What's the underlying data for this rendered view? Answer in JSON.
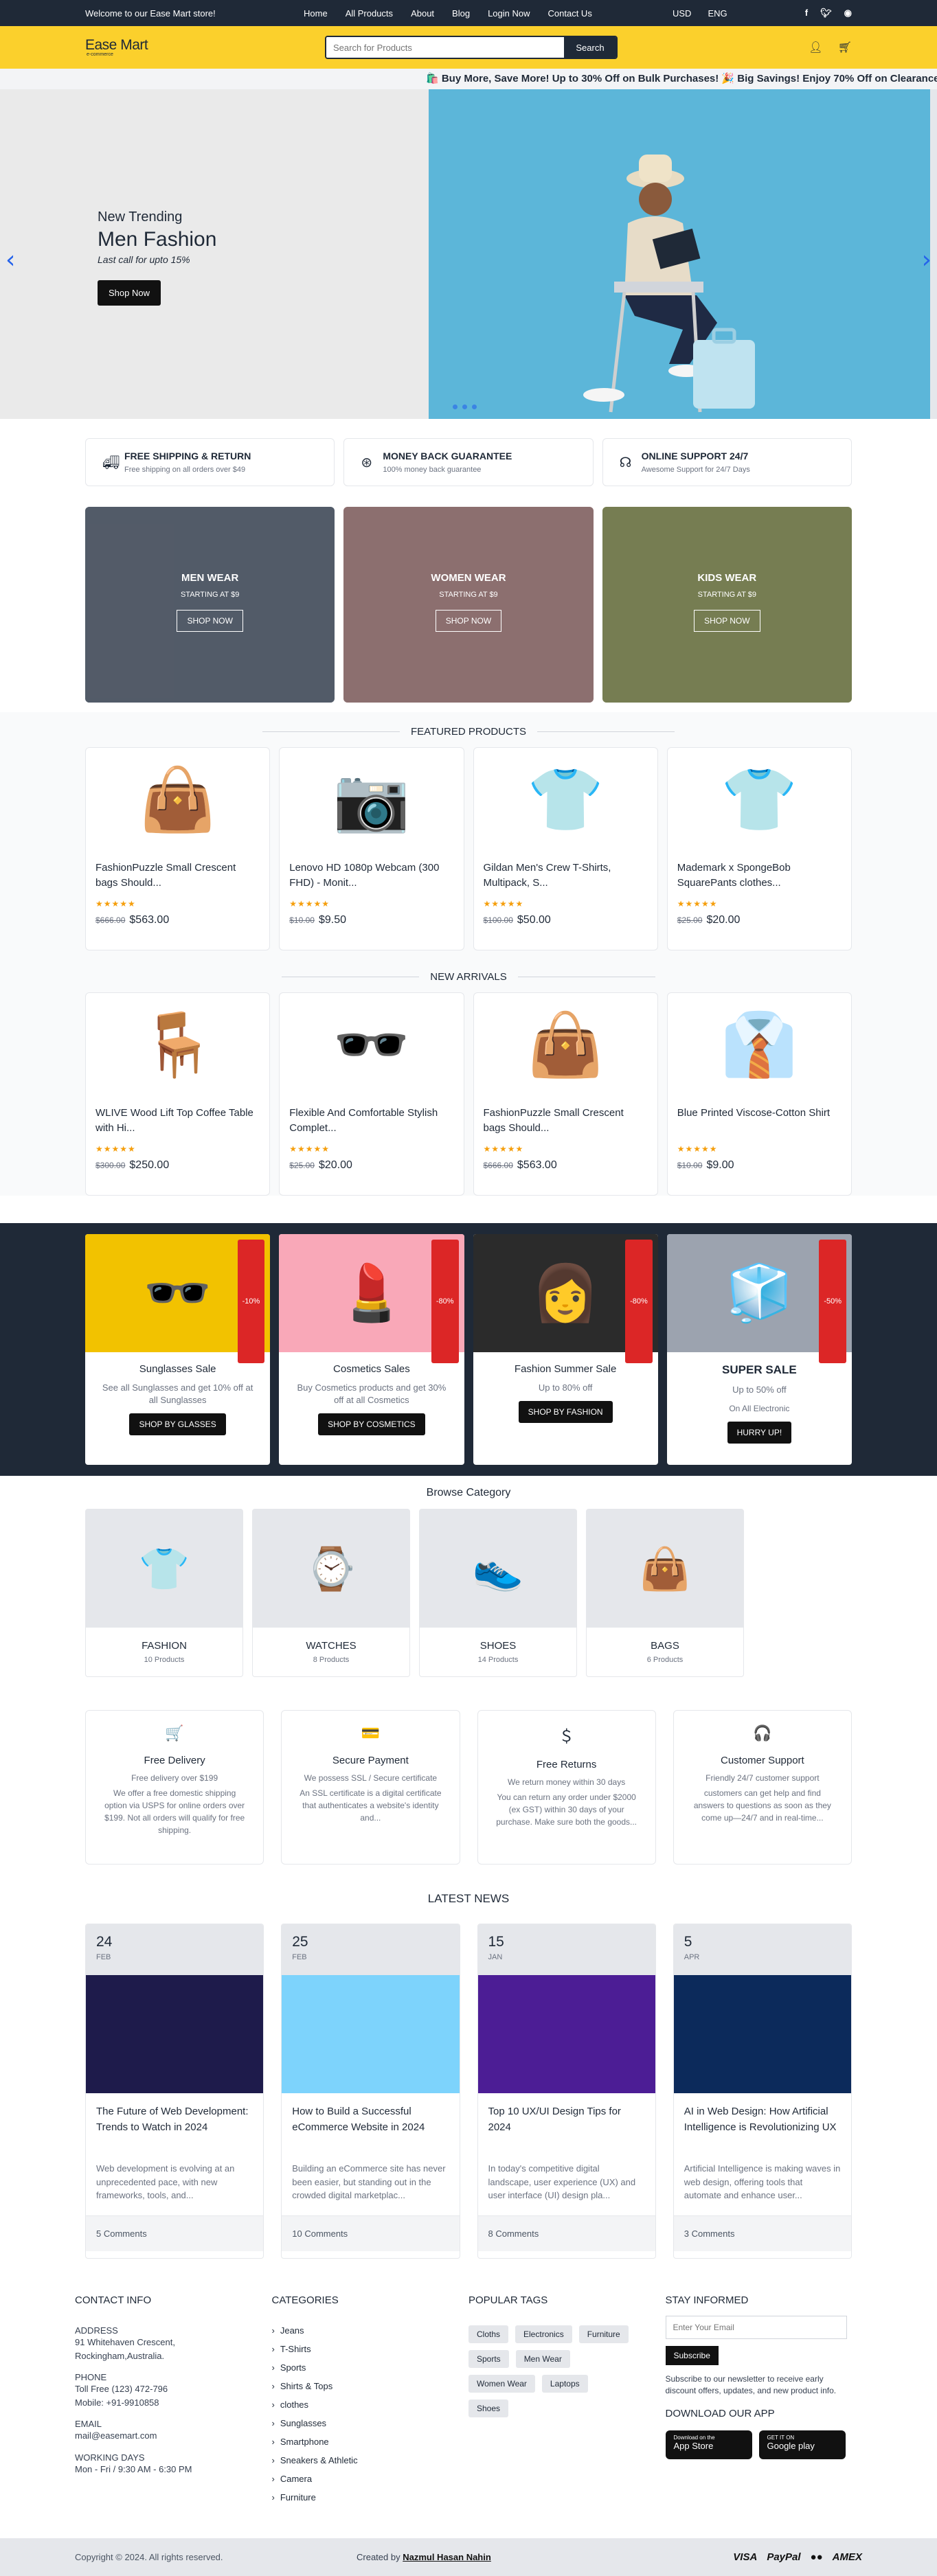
{
  "topbar": {
    "welcome": "Welcome to our Ease Mart store!",
    "nav": [
      "Home",
      "All Products",
      "About",
      "Blog",
      "Login Now",
      "Contact Us"
    ],
    "currency": "USD",
    "language": "ENG"
  },
  "header": {
    "logo": "Ease Mart",
    "logo_sub": "e-commerce",
    "search_placeholder": "Search for Products",
    "search_button": "Search"
  },
  "marquee": "🛍️ Buy More, Save More! Up to 30% Off on Bulk Purchases! 🎉 Big Savings! Enjoy 70% Off on Clearance Items",
  "hero": {
    "subtitle": "New Trending",
    "title": "Men Fashion",
    "note": "Last call for upto 15%",
    "button": "Shop Now"
  },
  "services": [
    {
      "title": "FREE SHIPPING & RETURN",
      "desc": "Free shipping on all orders over $49",
      "icon": "truck-icon"
    },
    {
      "title": "MONEY BACK GUARANTEE",
      "desc": "100% money back guarantee",
      "icon": "dollar-icon"
    },
    {
      "title": "ONLINE SUPPORT 24/7",
      "desc": "Awesome Support for 24/7 Days",
      "icon": "headset-icon"
    }
  ],
  "categories": [
    {
      "title": "MEN WEAR",
      "sub": "STARTING AT $9",
      "button": "SHOP NOW",
      "color": "#4a5d7a"
    },
    {
      "title": "WOMEN WEAR",
      "sub": "STARTING AT $9",
      "button": "SHOP NOW",
      "color": "#c98a8a"
    },
    {
      "title": "KIDS WEAR",
      "sub": "STARTING AT $9",
      "button": "SHOP NOW",
      "color": "#9aa84a"
    }
  ],
  "featured": {
    "heading": "FEATURED PRODUCTS",
    "items": [
      {
        "name": "FashionPuzzle Small Crescent bags Should...",
        "old": "$666.00",
        "price": "$563.00",
        "emoji": "👜"
      },
      {
        "name": "Lenovo HD 1080p Webcam (300 FHD) - Monit...",
        "old": "$10.00",
        "price": "$9.50",
        "emoji": "📷"
      },
      {
        "name": "Gildan Men's Crew T-Shirts, Multipack, S...",
        "old": "$100.00",
        "price": "$50.00",
        "emoji": "👕"
      },
      {
        "name": "Mademark x SpongeBob SquarePants clothes...",
        "old": "$25.00",
        "price": "$20.00",
        "emoji": "👕"
      }
    ]
  },
  "arrivals": {
    "heading": "NEW ARRIVALS",
    "items": [
      {
        "name": "WLIVE Wood Lift Top Coffee Table with Hi...",
        "old": "$300.00",
        "price": "$250.00",
        "emoji": "🪑"
      },
      {
        "name": "Flexible And Comfortable Stylish Complet...",
        "old": "$25.00",
        "price": "$20.00",
        "emoji": "🕶️"
      },
      {
        "name": "FashionPuzzle Small Crescent bags Should...",
        "old": "$666.00",
        "price": "$563.00",
        "emoji": "👜"
      },
      {
        "name": "Blue Printed Viscose-Cotton Shirt",
        "old": "$10.00",
        "price": "$9.00",
        "emoji": "👔"
      }
    ]
  },
  "stars": "★★★★★",
  "deals": [
    {
      "tag": "-10%",
      "title": "Sunglasses Sale",
      "desc": "See all Sunglasses and get 10% off at all Sunglasses",
      "button": "SHOP BY GLASSES",
      "bg": "#f2c200",
      "emoji": "🕶️"
    },
    {
      "tag": "-80%",
      "title": "Cosmetics Sales",
      "desc": "Buy Cosmetics products and get 30% off at all Cosmetics",
      "button": "SHOP BY COSMETICS",
      "bg": "#f9a8b8",
      "emoji": "💄"
    },
    {
      "tag": "-80%",
      "title": "Fashion Summer Sale",
      "desc": "Up to 80% off",
      "button": "SHOP BY FASHION",
      "bg": "#2b2b2b",
      "emoji": "👩"
    },
    {
      "tag": "-50%",
      "title": "SUPER SALE",
      "desc": "Up to 50% off",
      "desc2": "On All Electronic",
      "button": "HURRY UP!",
      "bg": "#9ca3af",
      "emoji": "🧊"
    }
  ],
  "browse": {
    "heading": "Browse Category",
    "items": [
      {
        "title": "FASHION",
        "count": "10 Products",
        "emoji": "👕"
      },
      {
        "title": "WATCHES",
        "count": "8 Products",
        "emoji": "⌚"
      },
      {
        "title": "SHOES",
        "count": "14 Products",
        "emoji": "👟"
      },
      {
        "title": "BAGS",
        "count": "6 Products",
        "emoji": "👜"
      }
    ]
  },
  "features": [
    {
      "title": "Free Delivery",
      "sub": "Free delivery over $199",
      "desc": "We offer a free domestic shipping option via USPS for online orders over $199. Not all orders will qualify for free shipping.",
      "icon": "🛒"
    },
    {
      "title": "Secure Payment",
      "sub": "We possess SSL / Secure certificate",
      "desc": "An SSL certificate is a digital certificate that authenticates a website's identity and...",
      "icon": "💳"
    },
    {
      "title": "Free Returns",
      "sub": "We return money within 30 days",
      "desc": "You can return any order under $2000 (ex GST) within 30 days of your purchase. Make sure both the goods...",
      "icon": "＄"
    },
    {
      "title": "Customer Support",
      "sub": "Friendly 24/7 customer support",
      "desc": "customers can get help and find answers to questions as soon as they come up—24/7 and in real-time...",
      "icon": "🎧"
    }
  ],
  "news": {
    "heading": "LATEST NEWS",
    "items": [
      {
        "day": "24",
        "month": "FEB",
        "title": "The Future of Web Development: Trends to Watch in 2024",
        "desc": "Web development is evolving at an unprecedented pace, with new frameworks, tools, and...",
        "comments": "5 Comments",
        "bg": "#1e1b4b"
      },
      {
        "day": "25",
        "month": "FEB",
        "title": "How to Build a Successful eCommerce Website in 2024",
        "desc": "Building an eCommerce site has never been easier, but standing out in the crowded digital marketplac...",
        "comments": "10 Comments",
        "bg": "#7dd3fc"
      },
      {
        "day": "15",
        "month": "JAN",
        "title": "Top 10 UX/UI Design Tips for 2024",
        "desc": "In today's competitive digital landscape, user experience (UX) and user interface (UI) design pla...",
        "comments": "8 Comments",
        "bg": "#4c1d95"
      },
      {
        "day": "5",
        "month": "APR",
        "title": "AI in Web Design: How Artificial Intelligence is Revolutionizing UX",
        "desc": "Artificial Intelligence is making waves in web design, offering tools that automate and enhance user...",
        "comments": "3 Comments",
        "bg": "#0c2a5b"
      }
    ]
  },
  "footer": {
    "contact_heading": "CONTACT INFO",
    "address_label": "ADDRESS",
    "address": "91 Whitehaven Crescent, Rockingham,Australia.",
    "phone_label": "PHONE",
    "phone1": "Toll Free (123) 472-796",
    "phone2": "Mobile: +91-9910858",
    "email_label": "EMAIL",
    "email": "mail@easemart.com",
    "hours_label": "WORKING DAYS",
    "hours": "Mon - Fri / 9:30 AM - 6:30 PM",
    "categories_heading": "CATEGORIES",
    "categories": [
      "Jeans",
      "T-Shirts",
      "Sports",
      "Shirts & Tops",
      "clothes",
      "Sunglasses",
      "Smartphone",
      "Sneakers & Athletic",
      "Camera",
      "Furniture"
    ],
    "tags_heading": "POPULAR TAGS",
    "tags": [
      "Cloths",
      "Electronics",
      "Furniture",
      "Sports",
      "Men Wear",
      "Women Wear",
      "Laptops",
      "Shoes"
    ],
    "stay_heading": "STAY INFORMED",
    "email_placeholder": "Enter Your Email",
    "subscribe": "Subscribe",
    "note": "Subscribe to our newsletter to receive early discount offers, updates, and new product info.",
    "app_heading": "DOWNLOAD OUR APP",
    "appstore_small": "Download on the",
    "appstore": "App Store",
    "google_small": "GET IT ON",
    "google": "Google play",
    "copyright": "Copyright © 2024. All rights reserved.",
    "created": "Created by",
    "author": "Nazmul Hasan Nahin",
    "payments": [
      "VISA",
      "PayPal",
      "●●",
      "AMEX"
    ]
  }
}
